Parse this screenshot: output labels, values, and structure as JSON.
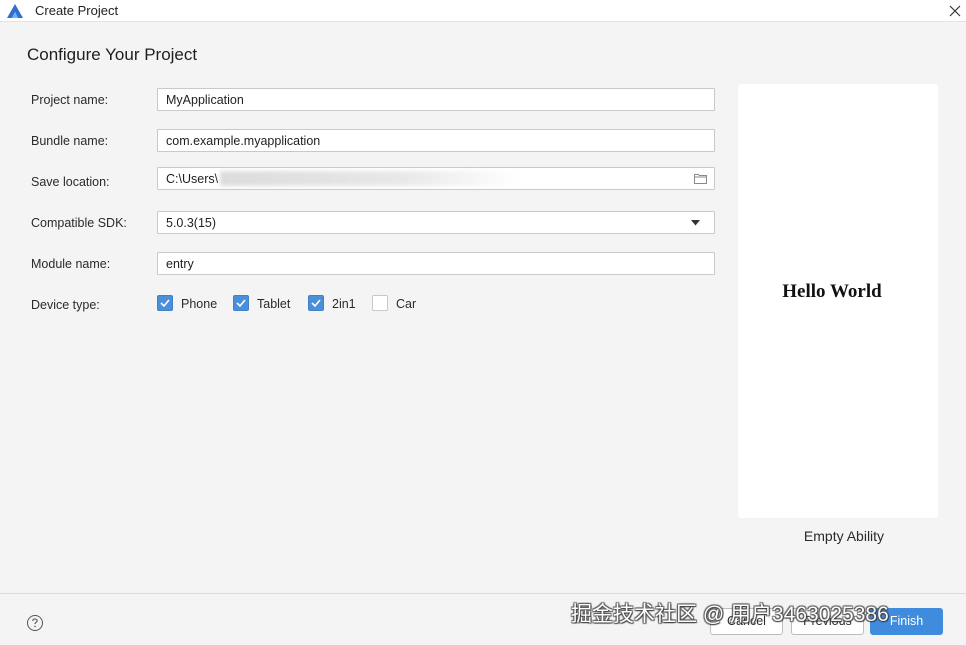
{
  "window": {
    "title": "Create Project"
  },
  "heading": "Configure Your Project",
  "form": {
    "project_name": {
      "label": "Project name:",
      "value": "MyApplication"
    },
    "bundle_name": {
      "label": "Bundle name:",
      "value": "com.example.myapplication"
    },
    "save_location": {
      "label": "Save location:",
      "value": "C:\\Users\\"
    },
    "compatible_sdk": {
      "label": "Compatible SDK:",
      "value": "5.0.3(15)"
    },
    "module_name": {
      "label": "Module name:",
      "value": "entry"
    },
    "device_type": {
      "label": "Device type:",
      "options": [
        {
          "label": "Phone",
          "checked": true
        },
        {
          "label": "Tablet",
          "checked": true
        },
        {
          "label": "2in1",
          "checked": true
        },
        {
          "label": "Car",
          "checked": false
        }
      ]
    }
  },
  "preview": {
    "content_text": "Hello World",
    "template_name": "Empty Ability"
  },
  "footer": {
    "cancel_label": "Cancel",
    "previous_label": "Previous",
    "finish_label": "Finish"
  },
  "watermark": "掘金技术社区 @ 用户3463025386",
  "colors": {
    "accent": "#4a8fd8",
    "primary_button": "#3f8cde",
    "background": "#f4f4f4"
  }
}
